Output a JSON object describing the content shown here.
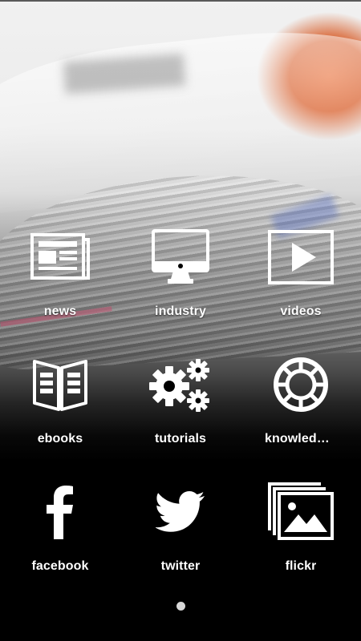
{
  "menu": {
    "items": [
      {
        "label": "news",
        "icon": "newspaper-icon"
      },
      {
        "label": "industry",
        "icon": "monitor-icon"
      },
      {
        "label": "videos",
        "icon": "play-icon"
      },
      {
        "label": "ebooks",
        "icon": "open-book-icon"
      },
      {
        "label": "tutorials",
        "icon": "gears-icon"
      },
      {
        "label": "knowledge...",
        "icon": "lifebuoy-icon"
      },
      {
        "label": "facebook",
        "icon": "facebook-icon"
      },
      {
        "label": "twitter",
        "icon": "twitter-bird-icon"
      },
      {
        "label": "flickr",
        "icon": "photo-gallery-icon"
      }
    ]
  },
  "pager": {
    "pages": 1,
    "current": 1
  },
  "colors": {
    "icon": "#ffffff",
    "label": "#ffffff",
    "background_bottom": "#000000",
    "accent_orange": "#e9703a"
  }
}
